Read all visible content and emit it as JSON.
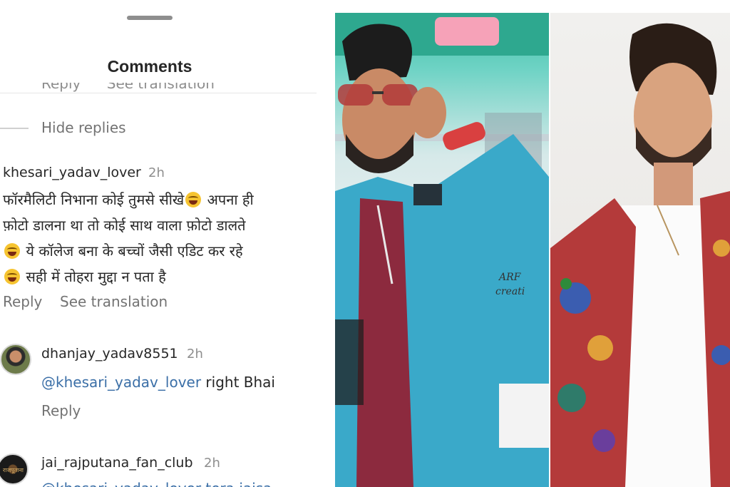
{
  "sheet": {
    "title": "Comments",
    "partial_row": {
      "reply": "Reply",
      "see_translation": "See translation"
    },
    "hide_replies": "Hide replies"
  },
  "comments": [
    {
      "username": "khesari_yadav_lover",
      "time": "2h",
      "lines": [
        "फॉरमैलिटी निभाना कोई तुमसे सीखे",
        "अपना ही",
        "फ़ोटो डालना था तो कोई साथ वाला फ़ोटो डालते",
        "ये कॉलेज बना के बच्चों जैसी एडिट कर रहे",
        "सही में तोहरा मुद्दा न पता है"
      ],
      "reply_label": "Reply",
      "translate_label": "See translation"
    },
    {
      "username": "dhanjay_yadav8551",
      "time": "2h",
      "mention": "@khesari_yadav_lover",
      "text": " right Bhai",
      "reply_label": "Reply"
    },
    {
      "username": "jai_rajputana_fan_club",
      "time": "2h",
      "avatar_text": "राजपूताना",
      "partial_text": "@khesari_yadav_lover tera jaisa"
    }
  ],
  "photos": {
    "left_caption": "ARF creati",
    "icons": [
      "laughing-emoji-icon"
    ]
  },
  "colors": {
    "accent_link": "#3b6fa7",
    "secondary_text": "#737373",
    "jacket_blue": "#3aa9c9",
    "jacket_red": "#8c2a3e"
  }
}
